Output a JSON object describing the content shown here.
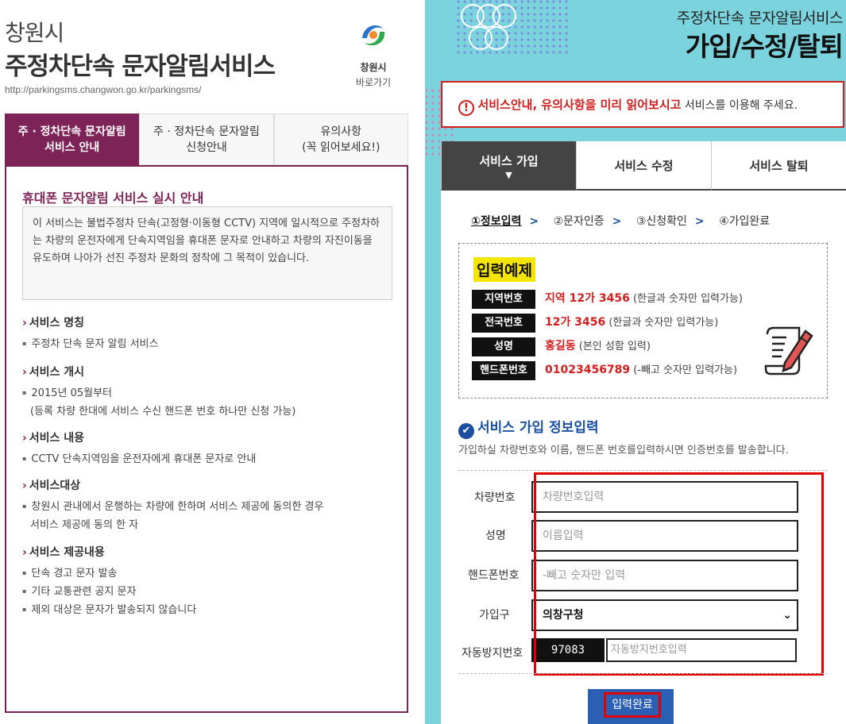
{
  "left": {
    "city": "창원시",
    "service_title": "주정차단속 문자알림서비스",
    "url": "http://parkingsms.changwon.go.kr/parkingsms/",
    "logo_name": "창원시",
    "logo_link": "바로가기",
    "tabs": [
      {
        "line1": "주 · 정차단속 문자알림",
        "line2": "서비스 안내"
      },
      {
        "line1": "주 · 정차단속 문자알림",
        "line2": "신청안내"
      },
      {
        "line1": "유의사항",
        "line2": "(꼭 읽어보세요!)"
      }
    ],
    "heading": "휴대폰 문자알림 서비스 실시 안내",
    "intro": "이 서비스는 불법주정차 단속(고정형·이동형 CCTV) 지역에 일시적으로 주정차하는 차량의 운전자에게 단속지역임을 휴대폰 문자로 안내하고 차량의 자진이동을 유도하며 나아가 선진 주정차 문화의 정착에 그 목적이 있습니다.",
    "sections": [
      {
        "title": "서비스 명칭",
        "items": [
          "주정차 단속 문자 알림 서비스"
        ]
      },
      {
        "title": "서비스 개시",
        "items": [
          "2015년 05월부터",
          "(등록 차량 한대에 서비스 수신 핸드폰 번호 하나만 신청 가능)"
        ]
      },
      {
        "title": "서비스 내용",
        "items": [
          "CCTV 단속지역임을 운전자에게 휴대폰 문자로 안내"
        ]
      },
      {
        "title": "서비스대상",
        "items": [
          "창원시 관내에서 운행하는 차량에 한하며 서비스 제공에 동의한 경우",
          "서비스 제공에 동의 한 자"
        ]
      },
      {
        "title": "서비스 제공내용",
        "items": [
          "단속 경고 문자 발송",
          "기타 교통관련 공지 문자",
          "제외 대상은 문자가 발송되지 않습니다"
        ]
      }
    ]
  },
  "right": {
    "subtitle": "주정차단속 문자알림서비스",
    "title": "가입/수정/탈퇴",
    "warning_icon": "!",
    "warning_red": "서비스안내, 유의사항을 미리 읽어보시고",
    "warning_rest": " 서비스를 이용해 주세요.",
    "tabs": [
      "서비스 가입",
      "서비스 수정",
      "서비스 탈퇴"
    ],
    "steps": [
      "①정보입력",
      "②문자인증",
      "③신청확인",
      "④가입완료"
    ],
    "step_arrow": ">",
    "example_title": "입력예제",
    "examples": [
      {
        "label": "지역번호",
        "value": "지역 12가 3456",
        "note": " (한글과 숫자만 입력가능)"
      },
      {
        "label": "전국번호",
        "value": "12가 3456",
        "note": " (한글과 숫자만 입력가능)"
      },
      {
        "label": "성명",
        "value": "홍길동",
        "note": " (본인 성함 입력)"
      },
      {
        "label": "핸드폰번호",
        "value": "01023456789",
        "note": " (-빼고 숫자만 입력가능)"
      }
    ],
    "form_title": "서비스 가입 정보입력",
    "form_desc": "가입하실 차량번호와 이름, 핸드폰 번호를입력하시면 인증번호를 발송합니다.",
    "fields": {
      "car_label": "차량번호",
      "car_placeholder": "차량번호입력",
      "name_label": "성명",
      "name_placeholder": "이름입력",
      "phone_label": "핸드폰번호",
      "phone_placeholder": "-빼고 숫자만 입력",
      "district_label": "가입구",
      "district_value": "의창구청",
      "captcha_label": "자동방지번호",
      "captcha_code": "97083",
      "captcha_placeholder": "자동방지번호입력"
    },
    "submit": "입력완료"
  },
  "colors": {
    "brand": "#7d2358",
    "accent_blue": "#1a4fa1",
    "warn_red": "#d21e1e",
    "bg_teal": "#7ad3dd"
  }
}
